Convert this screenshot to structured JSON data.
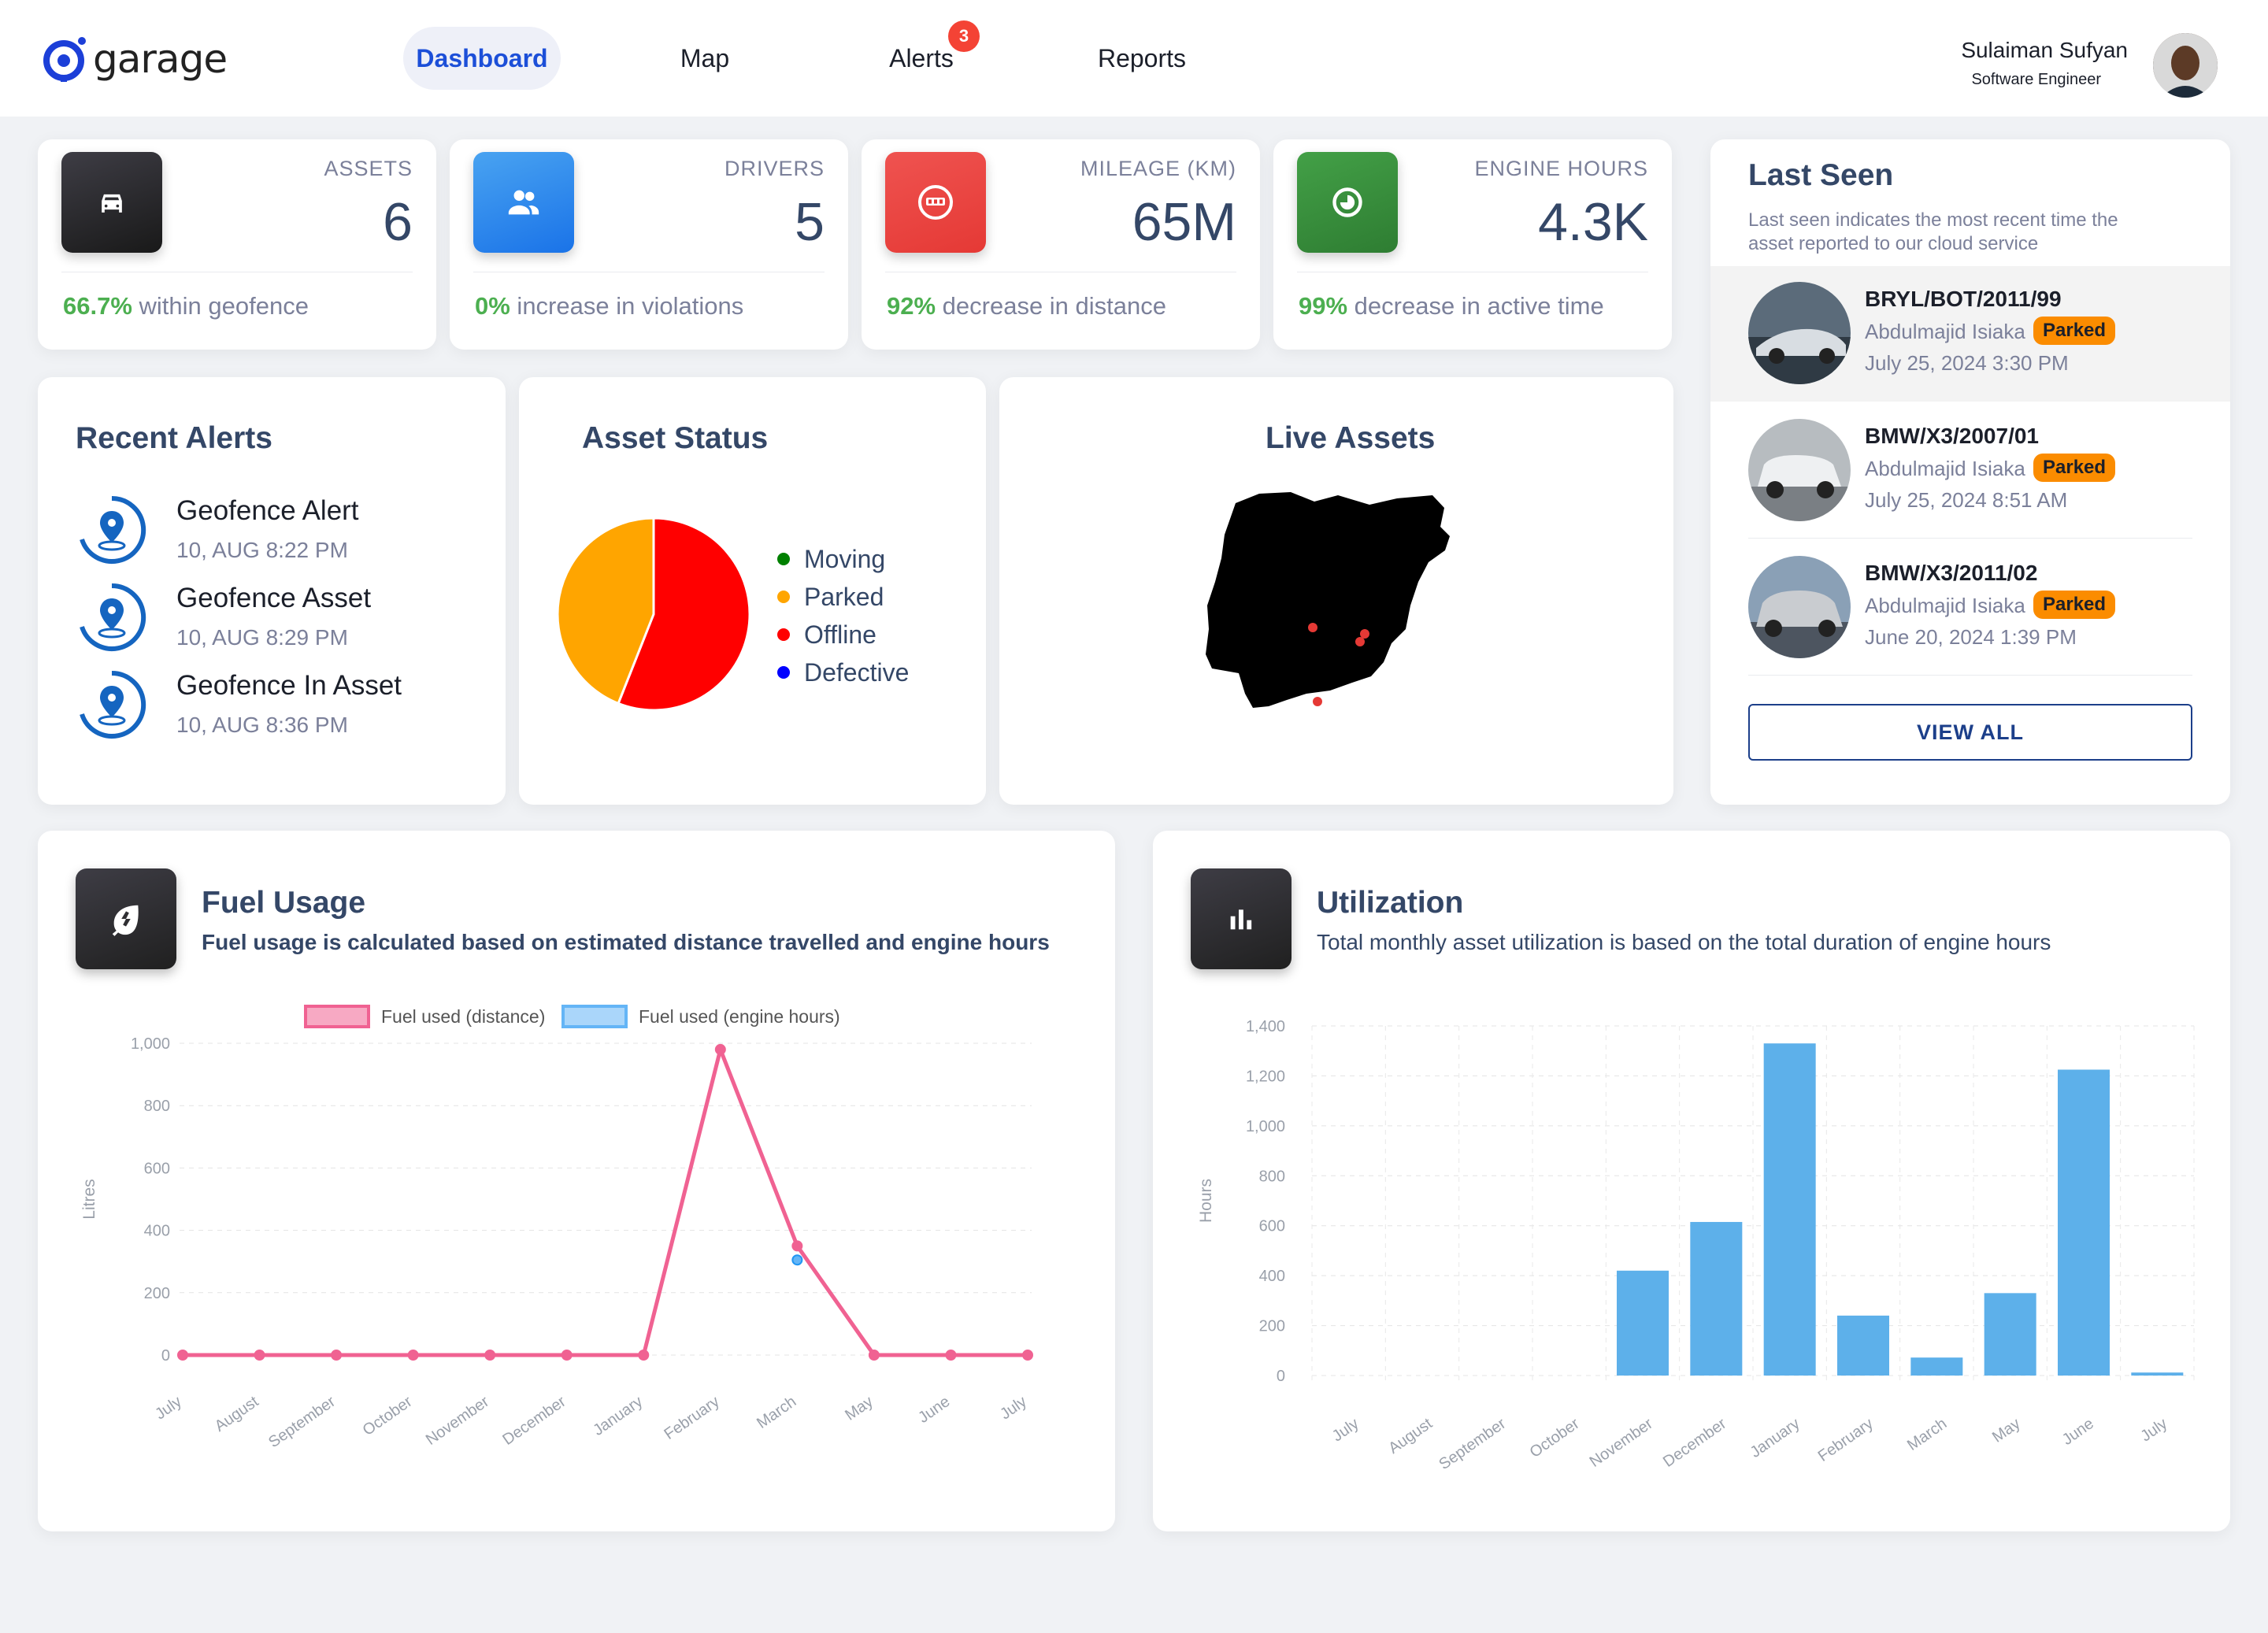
{
  "header": {
    "logo_text": "garage",
    "nav": [
      {
        "label": "Dashboard",
        "active": true
      },
      {
        "label": "Map",
        "active": false
      },
      {
        "label": "Alerts",
        "active": false,
        "badge": "3"
      },
      {
        "label": "Reports",
        "active": false
      }
    ],
    "user": {
      "name": "Sulaiman Sufyan",
      "role": "Software Engineer"
    }
  },
  "stats": [
    {
      "label": "ASSETS",
      "value": "6",
      "highlight": "66.7%",
      "foot": " within geofence",
      "icon": "car-icon",
      "color": "#222222"
    },
    {
      "label": "DRIVERS",
      "value": "5",
      "highlight": "0%",
      "foot": " increase in violations",
      "icon": "users-icon",
      "color": "#1a73e8"
    },
    {
      "label": "MILEAGE (KM)",
      "value": "65M",
      "highlight": "92%",
      "foot": " decrease in distance",
      "icon": "odometer-icon",
      "color": "#f44335"
    },
    {
      "label": "ENGINE HOURS",
      "value": "4.3K",
      "highlight": "99%",
      "foot": " decrease in active time",
      "icon": "clock-icon",
      "color": "#2e7d32"
    }
  ],
  "recent_alerts": {
    "title": "Recent Alerts",
    "items": [
      {
        "name": "Geofence Alert",
        "time": "10, AUG 8:22 PM"
      },
      {
        "name": "Geofence Asset",
        "time": "10, AUG 8:29 PM"
      },
      {
        "name": "Geofence In Asset",
        "time": "10, AUG 8:36 PM"
      }
    ]
  },
  "asset_status": {
    "title": "Asset Status",
    "legend": [
      {
        "label": "Moving",
        "color": "#008000"
      },
      {
        "label": "Parked",
        "color": "#ffa500"
      },
      {
        "label": "Offline",
        "color": "#ff0000"
      },
      {
        "label": "Defective",
        "color": "#0000ff"
      }
    ],
    "chart_data": {
      "type": "pie",
      "slices": [
        {
          "label": "Moving",
          "value": 0
        },
        {
          "label": "Parked",
          "value": 44
        },
        {
          "label": "Offline",
          "value": 56
        },
        {
          "label": "Defective",
          "value": 0
        }
      ]
    }
  },
  "live_assets": {
    "title": "Live Assets"
  },
  "last_seen": {
    "title": "Last Seen",
    "subtitle_1": "Last seen indicates the most recent time the",
    "subtitle_2": "asset reported to our cloud service",
    "items": [
      {
        "id": "BRYL/BOT/2011/99",
        "driver": "Abdulmajid Isiaka",
        "status": "Parked",
        "date": "July 25, 2024 3:30 PM"
      },
      {
        "id": "BMW/X3/2007/01",
        "driver": "Abdulmajid Isiaka",
        "status": "Parked",
        "date": "July 25, 2024 8:51 AM"
      },
      {
        "id": "BMW/X3/2011/02",
        "driver": "Abdulmajid Isiaka",
        "status": "Parked",
        "date": "June 20, 2024 1:39 PM"
      }
    ],
    "view_all": "VIEW ALL"
  },
  "fuel_usage": {
    "title": "Fuel Usage",
    "subtitle": "Fuel usage is calculated based on estimated distance travelled and engine hours",
    "chart_data": {
      "type": "line",
      "ylabel": "Litres",
      "ylim": [
        0,
        1000
      ],
      "yticks": [
        "0",
        "200",
        "400",
        "600",
        "800",
        "1,000"
      ],
      "categories": [
        "July",
        "August",
        "September",
        "October",
        "November",
        "December",
        "January",
        "February",
        "March",
        "May",
        "June",
        "July"
      ],
      "series": [
        {
          "name": "Fuel used (distance)",
          "color": "#f06292",
          "values": [
            0,
            0,
            0,
            0,
            0,
            0,
            0,
            980,
            350,
            0,
            0,
            0
          ]
        },
        {
          "name": "Fuel used (engine hours)",
          "color": "#64b5f6",
          "values": [
            null,
            null,
            null,
            null,
            null,
            null,
            null,
            null,
            305,
            null,
            null,
            null
          ]
        }
      ]
    }
  },
  "utilization": {
    "title": "Utilization",
    "subtitle": "Total monthly asset utilization is based on the total duration of engine hours",
    "chart_data": {
      "type": "bar",
      "ylabel": "Hours",
      "ylim": [
        0,
        1400
      ],
      "yticks": [
        "0",
        "200",
        "400",
        "600",
        "800",
        "1,000",
        "1,200",
        "1,400"
      ],
      "categories": [
        "July",
        "August",
        "September",
        "October",
        "November",
        "December",
        "January",
        "February",
        "March",
        "May",
        "June",
        "July"
      ],
      "values": [
        0,
        0,
        0,
        0,
        420,
        615,
        1330,
        240,
        72,
        330,
        1225,
        12
      ],
      "color": "#5db0ea"
    }
  }
}
